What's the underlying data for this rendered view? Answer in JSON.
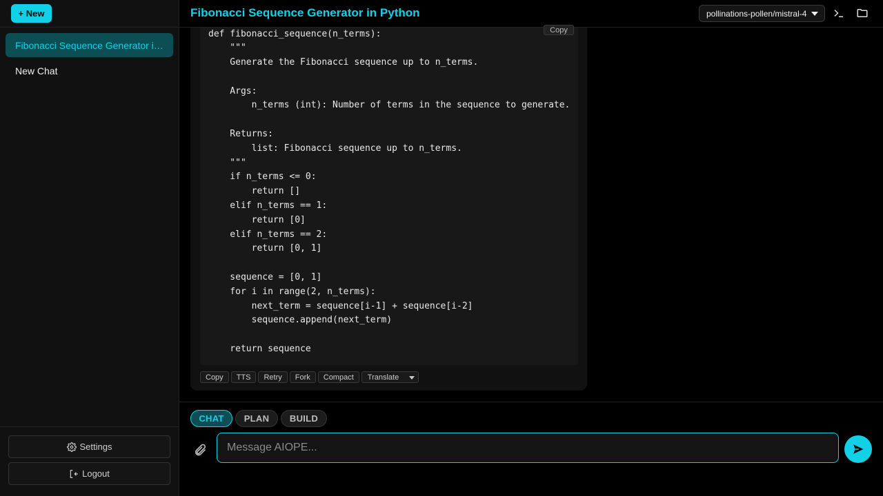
{
  "sidebar": {
    "new_label": "+ New",
    "chats": [
      {
        "label": "Fibonacci Sequence Generator in Python"
      },
      {
        "label": "New Chat"
      }
    ],
    "settings_label": "Settings",
    "logout_label": "Logout"
  },
  "header": {
    "title": "Fibonacci Sequence Generator in Python",
    "model": "pollinations-pollen/mistral-4"
  },
  "message": {
    "copy_code_label": "Copy",
    "code_lines": [
      "def fibonacci_sequence(n_terms):",
      "    \"\"\"",
      "    Generate the Fibonacci sequence up to n_terms.",
      "",
      "    Args:",
      "        n_terms (int): Number of terms in the sequence to generate.",
      "",
      "    Returns:",
      "        list: Fibonacci sequence up to n_terms.",
      "    \"\"\"",
      "    if n_terms <= 0:",
      "        return []",
      "    elif n_terms == 1:",
      "        return [0]",
      "    elif n_terms == 2:",
      "        return [0, 1]",
      "",
      "    sequence = [0, 1]",
      "    for i in range(2, n_terms):",
      "        next_term = sequence[i-1] + sequence[i-2]",
      "        sequence.append(next_term)",
      "",
      "    return sequence"
    ],
    "actions": {
      "copy": "Copy",
      "tts": "TTS",
      "retry": "Retry",
      "fork": "Fork",
      "compact": "Compact",
      "translate": "Translate"
    }
  },
  "composer": {
    "modes": {
      "chat": "CHAT",
      "plan": "PLAN",
      "build": "BUILD"
    },
    "active_mode": "CHAT",
    "placeholder": "Message AIOPE...",
    "value": ""
  },
  "colors": {
    "accent": "#12d0e6",
    "active_bg": "#0d4e55"
  }
}
